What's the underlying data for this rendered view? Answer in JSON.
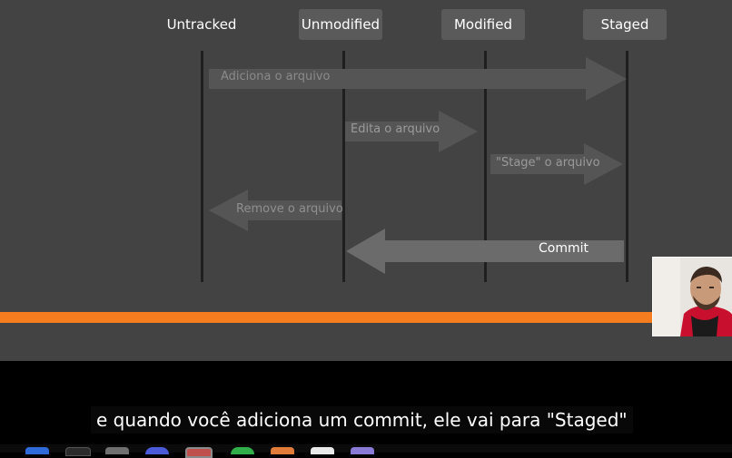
{
  "states": [
    {
      "label": "Untracked"
    },
    {
      "label": "Unmodified"
    },
    {
      "label": "Modified"
    },
    {
      "label": "Staged"
    }
  ],
  "transitions": [
    {
      "label": "Adiciona o arquivo",
      "from": "Untracked",
      "to": "Staged"
    },
    {
      "label": "Edita o arquivo",
      "from": "Unmodified",
      "to": "Modified"
    },
    {
      "label": "\"Stage\" o arquivo",
      "from": "Modified",
      "to": "Staged"
    },
    {
      "label": "Remove o arquivo",
      "from": "Unmodified",
      "to": "Untracked"
    },
    {
      "label": "Commit",
      "from": "Staged",
      "to": "Unmodified"
    }
  ],
  "colors": {
    "slide_background": "#434343",
    "state_box": "#5a5a5a",
    "faded_arrow": "#555555",
    "commit_arrow": "#6b6b6b",
    "accent_band": "#f57c1f"
  },
  "subtitle": {
    "text": "e quando você adiciona um commit, ele vai para \"Staged\""
  },
  "taskbar": {
    "icons": [
      "finder-icon",
      "terminal-icon",
      "app-icon",
      "browser-icon",
      "active-app-icon",
      "chat-icon",
      "app-icon",
      "document-icon",
      "app-icon"
    ]
  }
}
